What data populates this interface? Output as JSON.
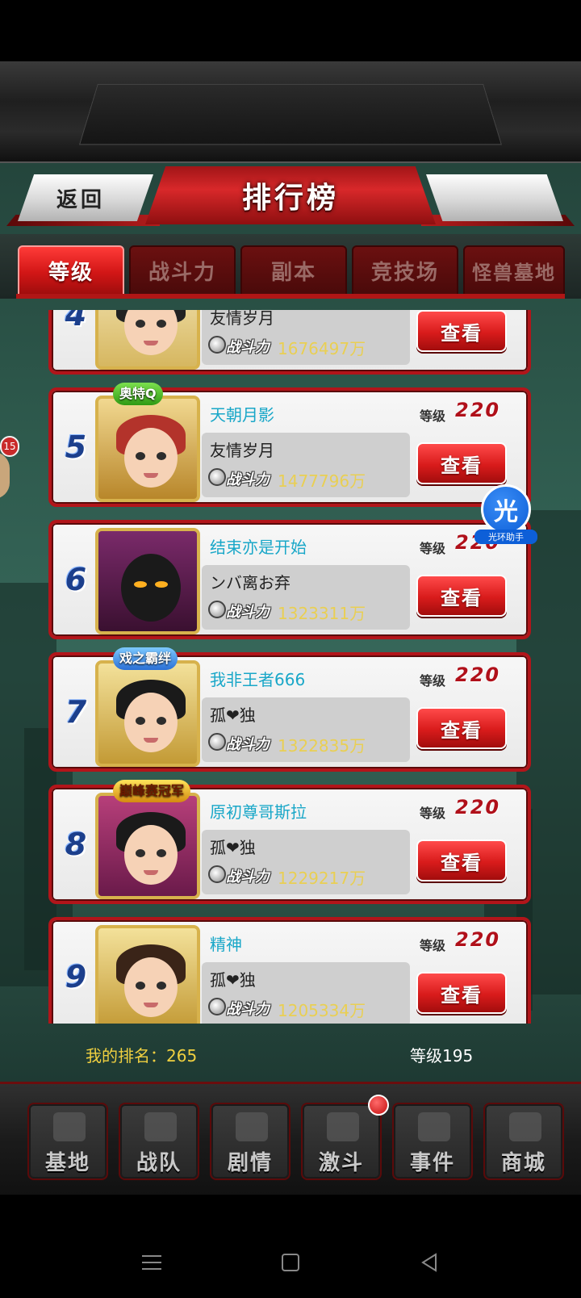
{
  "header": {
    "back_label": "返回",
    "title": "排行榜"
  },
  "tabs": [
    {
      "label": "等级",
      "active": true
    },
    {
      "label": "战斗力",
      "active": false
    },
    {
      "label": "副本",
      "active": false
    },
    {
      "label": "竞技场",
      "active": false
    },
    {
      "label": "怪兽墓地",
      "active": false
    }
  ],
  "list": {
    "level_label": "等级",
    "cp_label": "战斗力",
    "view_label": "查看",
    "rows": [
      {
        "rank": "4",
        "name": "",
        "guild": "友情岁月",
        "level": "",
        "power": "1676497万",
        "badge": ""
      },
      {
        "rank": "5",
        "name": "天朝月影",
        "guild": "友情岁月",
        "level": "220",
        "power": "1477796万",
        "badge": "奥特Q"
      },
      {
        "rank": "6",
        "name": "结束亦是开始",
        "guild": "ンバ离お弃",
        "level": "220",
        "power": "1323311万",
        "badge": ""
      },
      {
        "rank": "7",
        "name": "我非王者666",
        "guild": "孤❤独",
        "level": "220",
        "power": "1322835万",
        "badge": "戏之霸绊"
      },
      {
        "rank": "8",
        "name": "原初尊哥斯拉",
        "guild": "孤❤独",
        "level": "220",
        "power": "1229217万",
        "badge": "巅峰赛冠军"
      },
      {
        "rank": "9",
        "name": "精神",
        "guild": "孤❤独",
        "level": "220",
        "power": "1205334万",
        "badge": ""
      }
    ]
  },
  "float_helper": {
    "glyph": "光",
    "caption": "光环助手"
  },
  "side_bubble": "15",
  "footer": {
    "my_rank": "我的排名：265",
    "my_level": "等级195"
  },
  "nav": [
    {
      "label": "基地"
    },
    {
      "label": "战队"
    },
    {
      "label": "剧情"
    },
    {
      "label": "激斗"
    },
    {
      "label": "事件"
    },
    {
      "label": "商城"
    }
  ],
  "colors": {
    "accent_red": "#d21616",
    "name_cyan": "#19a7c8",
    "power_gold": "#e9cf53",
    "rank_yellow": "#f0d040"
  }
}
